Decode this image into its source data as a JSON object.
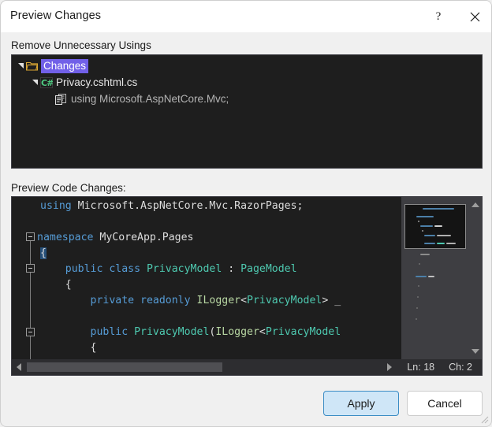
{
  "window": {
    "title": "Preview Changes",
    "help_label": "?",
    "close_label": "✕"
  },
  "tree": {
    "label": "Remove Unnecessary Usings",
    "nodes": [
      {
        "label": "Changes",
        "icon": "folder-icon",
        "expanded": true,
        "selected": true
      },
      {
        "label": "Privacy.cshtml.cs",
        "icon": "csharp-file-icon",
        "expanded": true,
        "selected": false
      },
      {
        "label": "using Microsoft.AspNetCore.Mvc;",
        "icon": "using-statement-icon",
        "expanded": false,
        "selected": false
      }
    ]
  },
  "code": {
    "label": "Preview Code Changes:",
    "lines": [
      {
        "n": 1,
        "indent": 4,
        "text": "using Microsoft.AspNetCore.Mvc.RazorPages;"
      },
      {
        "n": 2,
        "indent": 0,
        "text": ""
      },
      {
        "n": 3,
        "indent": 0,
        "text": "namespace MyCoreApp.Pages"
      },
      {
        "n": 4,
        "indent": 1,
        "text": "{"
      },
      {
        "n": 5,
        "indent": 4,
        "text": "public class PrivacyModel : PageModel"
      },
      {
        "n": 6,
        "indent": 4,
        "text": "{"
      },
      {
        "n": 7,
        "indent": 8,
        "text": "private readonly ILogger<PrivacyModel> _"
      },
      {
        "n": 8,
        "indent": 0,
        "text": ""
      },
      {
        "n": 9,
        "indent": 8,
        "text": "public PrivacyModel(ILogger<PrivacyModel"
      },
      {
        "n": 10,
        "indent": 8,
        "text": "{"
      }
    ],
    "status": {
      "line_label": "Ln: 18",
      "column_label": "Ch: 2"
    },
    "colors": {
      "background": "#1e1e1e",
      "keyword": "#569cd6",
      "type": "#4ec9b0",
      "interface": "#b8d7a3",
      "plain": "#dcdcdc",
      "selection": "#264f78"
    }
  },
  "footer": {
    "apply_label": "Apply",
    "cancel_label": "Cancel"
  },
  "theme": {
    "dialog_background": "#f0f0f0",
    "titlebar_background": "#ffffff",
    "tree_selection": "#7160e8",
    "accent": "#3b8cc4"
  }
}
